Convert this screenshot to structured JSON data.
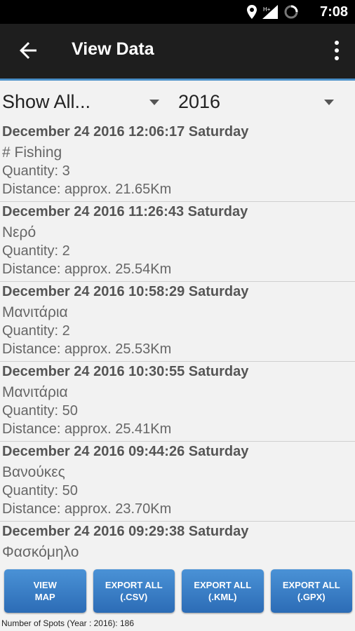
{
  "status_bar": {
    "time": "7:08"
  },
  "app_bar": {
    "title": "View Data"
  },
  "filters": {
    "category": "Show All...",
    "year": "2016"
  },
  "records": [
    {
      "date": "December 24 2016 12:06:17 Saturday",
      "name": "# Fishing",
      "quantity": "Quantity: 3",
      "distance": "Distance: approx. 21.65Km"
    },
    {
      "date": "December 24 2016 11:26:43 Saturday",
      "name": "Νερό",
      "quantity": "Quantity: 2",
      "distance": "Distance: approx. 25.54Km"
    },
    {
      "date": "December 24 2016 10:58:29 Saturday",
      "name": "Μανιτάρια",
      "quantity": "Quantity: 2",
      "distance": "Distance: approx. 25.53Km"
    },
    {
      "date": "December 24 2016 10:30:55 Saturday",
      "name": "Μανιτάρια",
      "quantity": "Quantity: 50",
      "distance": "Distance: approx. 25.41Km"
    },
    {
      "date": "December 24 2016 09:44:26 Saturday",
      "name": "Βανούκες",
      "quantity": "Quantity: 50",
      "distance": "Distance: approx. 23.70Km"
    },
    {
      "date": "December 24 2016 09:29:38 Saturday",
      "name": "Φασκόμηλο",
      "quantity": "",
      "distance": ""
    }
  ],
  "buttons": {
    "view_map": [
      "VIEW",
      "MAP"
    ],
    "export_csv": [
      "EXPORT ALL",
      "(.CSV)"
    ],
    "export_kml": [
      "EXPORT ALL",
      "(.KML)"
    ],
    "export_gpx": [
      "EXPORT ALL",
      "(.GPX)"
    ]
  },
  "footer": {
    "summary": "Number of Spots (Year : 2016): 186"
  },
  "colors": {
    "accent": "#4a90c8",
    "button": "#3a7fc8",
    "app_bar": "#1e1e1e"
  }
}
